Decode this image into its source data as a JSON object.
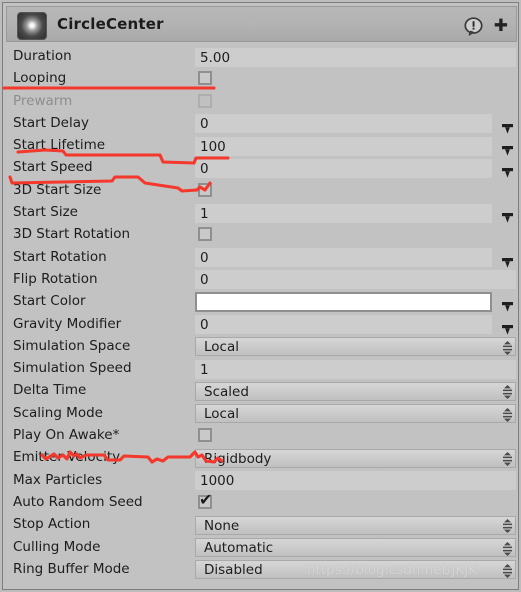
{
  "component": {
    "title": "CircleCenter",
    "thumbnail_icon": "particle-glow-thumbnail",
    "help_icon": "help-bubble-icon",
    "add_icon": "plus-icon"
  },
  "icons": {
    "curve_dropdown": "chevron-down-icon",
    "enum_popup": "up-down-arrows-icon",
    "checkbox_checked": "checkmark-icon"
  },
  "watermark": {
    "text": "https://blog.csdn.net/JKJK"
  },
  "colors": {
    "panel_background": "#c2c2c2",
    "field_background": "#cdcdcd",
    "text": "#1d1d1d",
    "disabled_text": "#8d8d8d",
    "annotation": "#f4382c",
    "start_color_swatch": "#ffffff"
  },
  "properties": [
    {
      "label": "Duration",
      "type": "text",
      "value": "5.00",
      "width": "full",
      "arrow": "none"
    },
    {
      "label": "Looping",
      "type": "checkbox",
      "checked": false,
      "arrow": "none"
    },
    {
      "label": "Prewarm",
      "type": "checkbox",
      "checked": false,
      "disabled": true,
      "arrow": "none"
    },
    {
      "label": "Start Delay",
      "type": "text",
      "value": "0",
      "width": "curve",
      "arrow": "curve"
    },
    {
      "label": "Start Lifetime",
      "type": "text",
      "value": "100",
      "width": "curve",
      "arrow": "curve"
    },
    {
      "label": "Start Speed",
      "type": "text",
      "value": "0",
      "width": "curve",
      "arrow": "curve"
    },
    {
      "label": "3D Start Size",
      "type": "checkbox",
      "checked": false,
      "arrow": "none"
    },
    {
      "label": "Start Size",
      "type": "text",
      "value": "1",
      "width": "curve",
      "arrow": "curve"
    },
    {
      "label": "3D Start Rotation",
      "type": "checkbox",
      "checked": false,
      "arrow": "none"
    },
    {
      "label": "Start Rotation",
      "type": "text",
      "value": "0",
      "width": "curve",
      "arrow": "curve"
    },
    {
      "label": "Flip Rotation",
      "type": "text",
      "value": "0",
      "width": "full",
      "arrow": "none"
    },
    {
      "label": "Start Color",
      "type": "color",
      "value": "#ffffff",
      "arrow": "curve"
    },
    {
      "label": "Gravity Modifier",
      "type": "text",
      "value": "0",
      "width": "curve",
      "arrow": "curve"
    },
    {
      "label": "Simulation Space",
      "type": "popup",
      "value": "Local",
      "width": "full",
      "arrow": "popup"
    },
    {
      "label": "Simulation Speed",
      "type": "text",
      "value": "1",
      "width": "full",
      "arrow": "none"
    },
    {
      "label": "Delta Time",
      "type": "popup",
      "value": "Scaled",
      "width": "full",
      "arrow": "popup"
    },
    {
      "label": "Scaling Mode",
      "type": "popup",
      "value": "Local",
      "width": "full",
      "arrow": "popup"
    },
    {
      "label": "Play On Awake*",
      "type": "checkbox",
      "checked": false,
      "arrow": "none"
    },
    {
      "label": "Emitter Velocity",
      "type": "popup",
      "value": "Rigidbody",
      "width": "full",
      "arrow": "popup"
    },
    {
      "label": "Max Particles",
      "type": "text",
      "value": "1000",
      "width": "full",
      "arrow": "none"
    },
    {
      "label": "Auto Random Seed",
      "type": "checkbox",
      "checked": true,
      "arrow": "none"
    },
    {
      "label": "Stop Action",
      "type": "popup",
      "value": "None",
      "width": "full",
      "arrow": "popup"
    },
    {
      "label": "Culling Mode",
      "type": "popup",
      "value": "Automatic",
      "width": "full",
      "arrow": "popup"
    },
    {
      "label": "Ring Buffer Mode",
      "type": "popup",
      "value": "Disabled",
      "width": "full",
      "arrow": "popup"
    }
  ]
}
